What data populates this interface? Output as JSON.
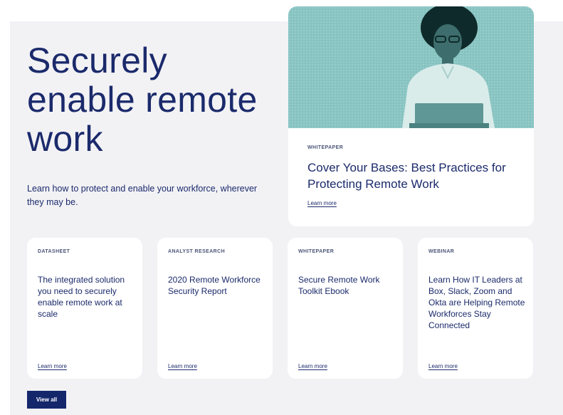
{
  "hero": {
    "title": "Securely enable remote work",
    "subtitle": "Learn how to protect and enable your workforce, wherever they may be."
  },
  "featured": {
    "image": "person-with-laptop-photo",
    "image_color": "#86c3c1",
    "eyebrow": "WHITEPAPER",
    "title": "Cover Your Bases: Best Practices for Protecting Remote Work",
    "link": "Learn more"
  },
  "cards": [
    {
      "eyebrow": "DATASHEET",
      "title": "The integrated solution you need to securely enable remote work at scale",
      "link": "Learn more"
    },
    {
      "eyebrow": "ANALYST RESEARCH",
      "title": "2020 Remote Workforce Security Report",
      "link": "Learn more"
    },
    {
      "eyebrow": "WHITEPAPER",
      "title": "Secure Remote Work Toolkit Ebook",
      "link": "Learn more"
    },
    {
      "eyebrow": "WEBINAR",
      "title": "Learn How IT Leaders at Box, Slack, Zoom and Okta are Helping Remote Workforces Stay Connected",
      "link": "Learn more"
    }
  ],
  "view_all": "View all",
  "colors": {
    "brand_navy": "#1b2a6b",
    "button_navy": "#14276b",
    "panel_bg": "#f2f2f5",
    "teal": "#86c3c1"
  }
}
